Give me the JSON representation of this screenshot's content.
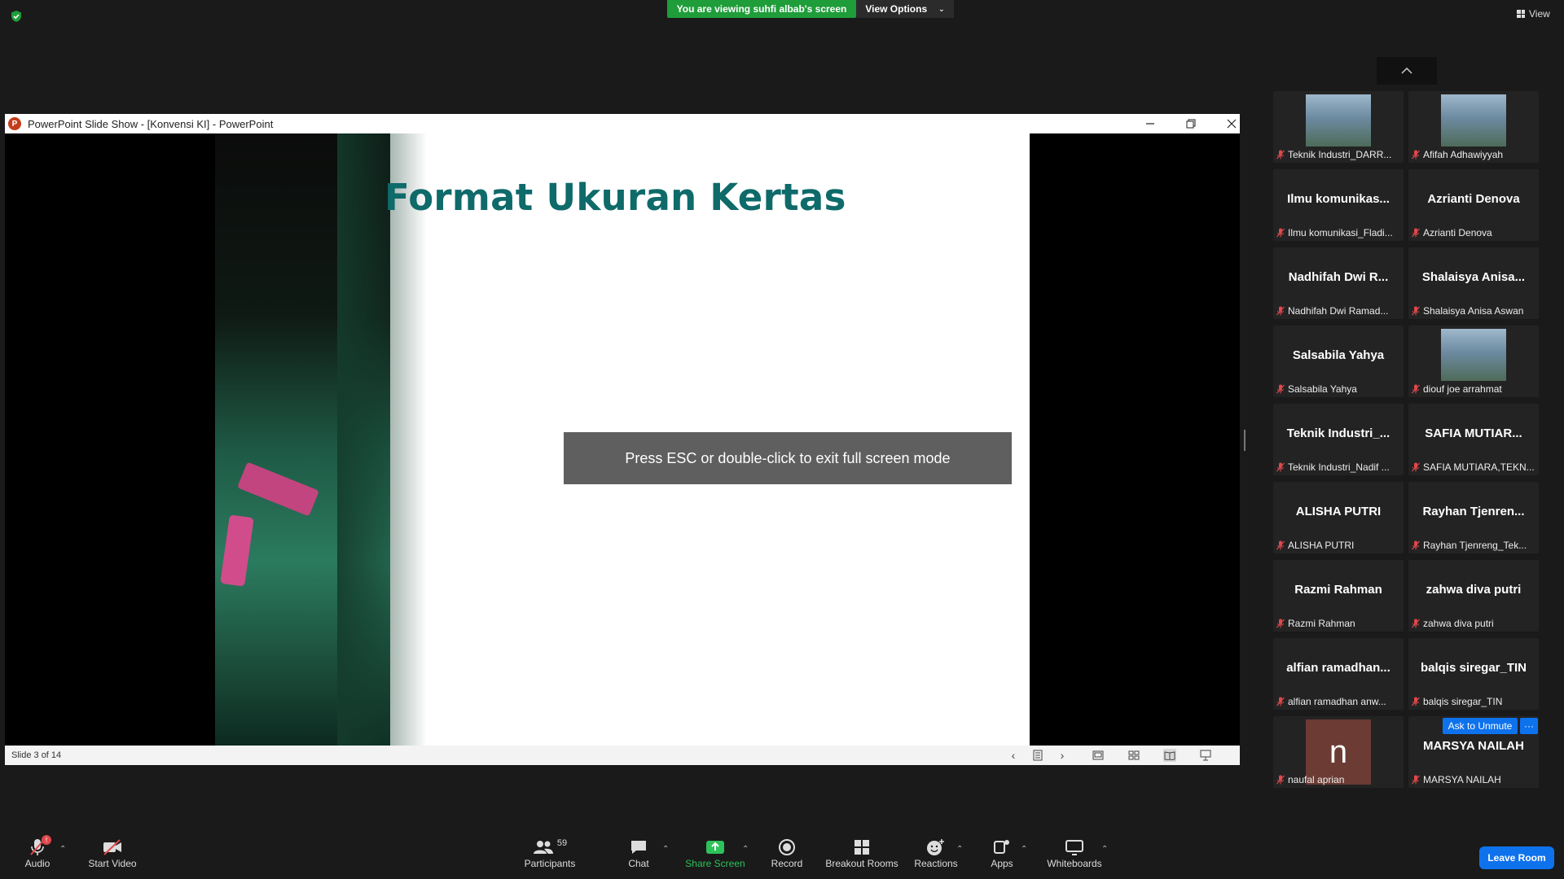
{
  "top": {
    "viewing_banner": "You are viewing suhfi albab's screen",
    "view_options": "View Options",
    "view_label": "View"
  },
  "window": {
    "title": "PowerPoint Slide Show - [Konvensi KI] - PowerPoint",
    "slide_title": "Format Ukuran Kertas",
    "esc_notice": "Press ESC or double-click to exit full screen mode",
    "slide_status": "Slide 3 of 14"
  },
  "participants": [
    {
      "big": "",
      "label": "Teknik Industri_DARR...",
      "photo": true
    },
    {
      "big": "",
      "label": "Afifah Adhawiyyah",
      "photo": true
    },
    {
      "big": "Ilmu komunikas...",
      "label": "Ilmu komunikasi_Fladi..."
    },
    {
      "big": "Azrianti Denova",
      "label": "Azrianti Denova"
    },
    {
      "big": "Nadhifah Dwi R...",
      "label": "Nadhifah Dwi Ramad..."
    },
    {
      "big": "Shalaisya Anisa...",
      "label": "Shalaisya Anisa Aswan"
    },
    {
      "big": "Salsabila Yahya",
      "label": "Salsabila Yahya"
    },
    {
      "big": "",
      "label": "diouf joe arrahmat",
      "photo": true
    },
    {
      "big": "Teknik Industri_...",
      "label": "Teknik Industri_Nadif ..."
    },
    {
      "big": "SAFIA MUTIAR...",
      "label": "SAFIA MUTIARA,TEKN..."
    },
    {
      "big": "ALISHA PUTRI",
      "label": "ALISHA PUTRI"
    },
    {
      "big": "Rayhan Tjenren...",
      "label": "Rayhan Tjenreng_Tek..."
    },
    {
      "big": "Razmi Rahman",
      "label": "Razmi Rahman"
    },
    {
      "big": "zahwa diva putri",
      "label": "zahwa diva putri"
    },
    {
      "big": "alfian ramadhan...",
      "label": "alfian ramadhan anw..."
    },
    {
      "big": "balqis siregar_TIN",
      "label": "balqis siregar_TIN"
    },
    {
      "big": "",
      "label": "naufal aprian",
      "avatar_letter": "n"
    },
    {
      "big": "MARSYA NAILAH",
      "label": "MARSYA NAILAH"
    }
  ],
  "ask_to_unmute": "Ask to Unmute",
  "more_label": "···",
  "toolbar": {
    "audio": "Audio",
    "audio_badge": "!",
    "start_video": "Start Video",
    "participants": "Participants",
    "participants_count": "59",
    "chat": "Chat",
    "share_screen": "Share Screen",
    "record": "Record",
    "breakout_rooms": "Breakout Rooms",
    "reactions": "Reactions",
    "apps": "Apps",
    "whiteboards": "Whiteboards",
    "leave_room": "Leave Room"
  },
  "colors": {
    "share_green": "#1f9d3a",
    "zoom_blue": "#0e72ed",
    "slide_title": "#0f6a6a",
    "muted_red": "#e0484b"
  }
}
